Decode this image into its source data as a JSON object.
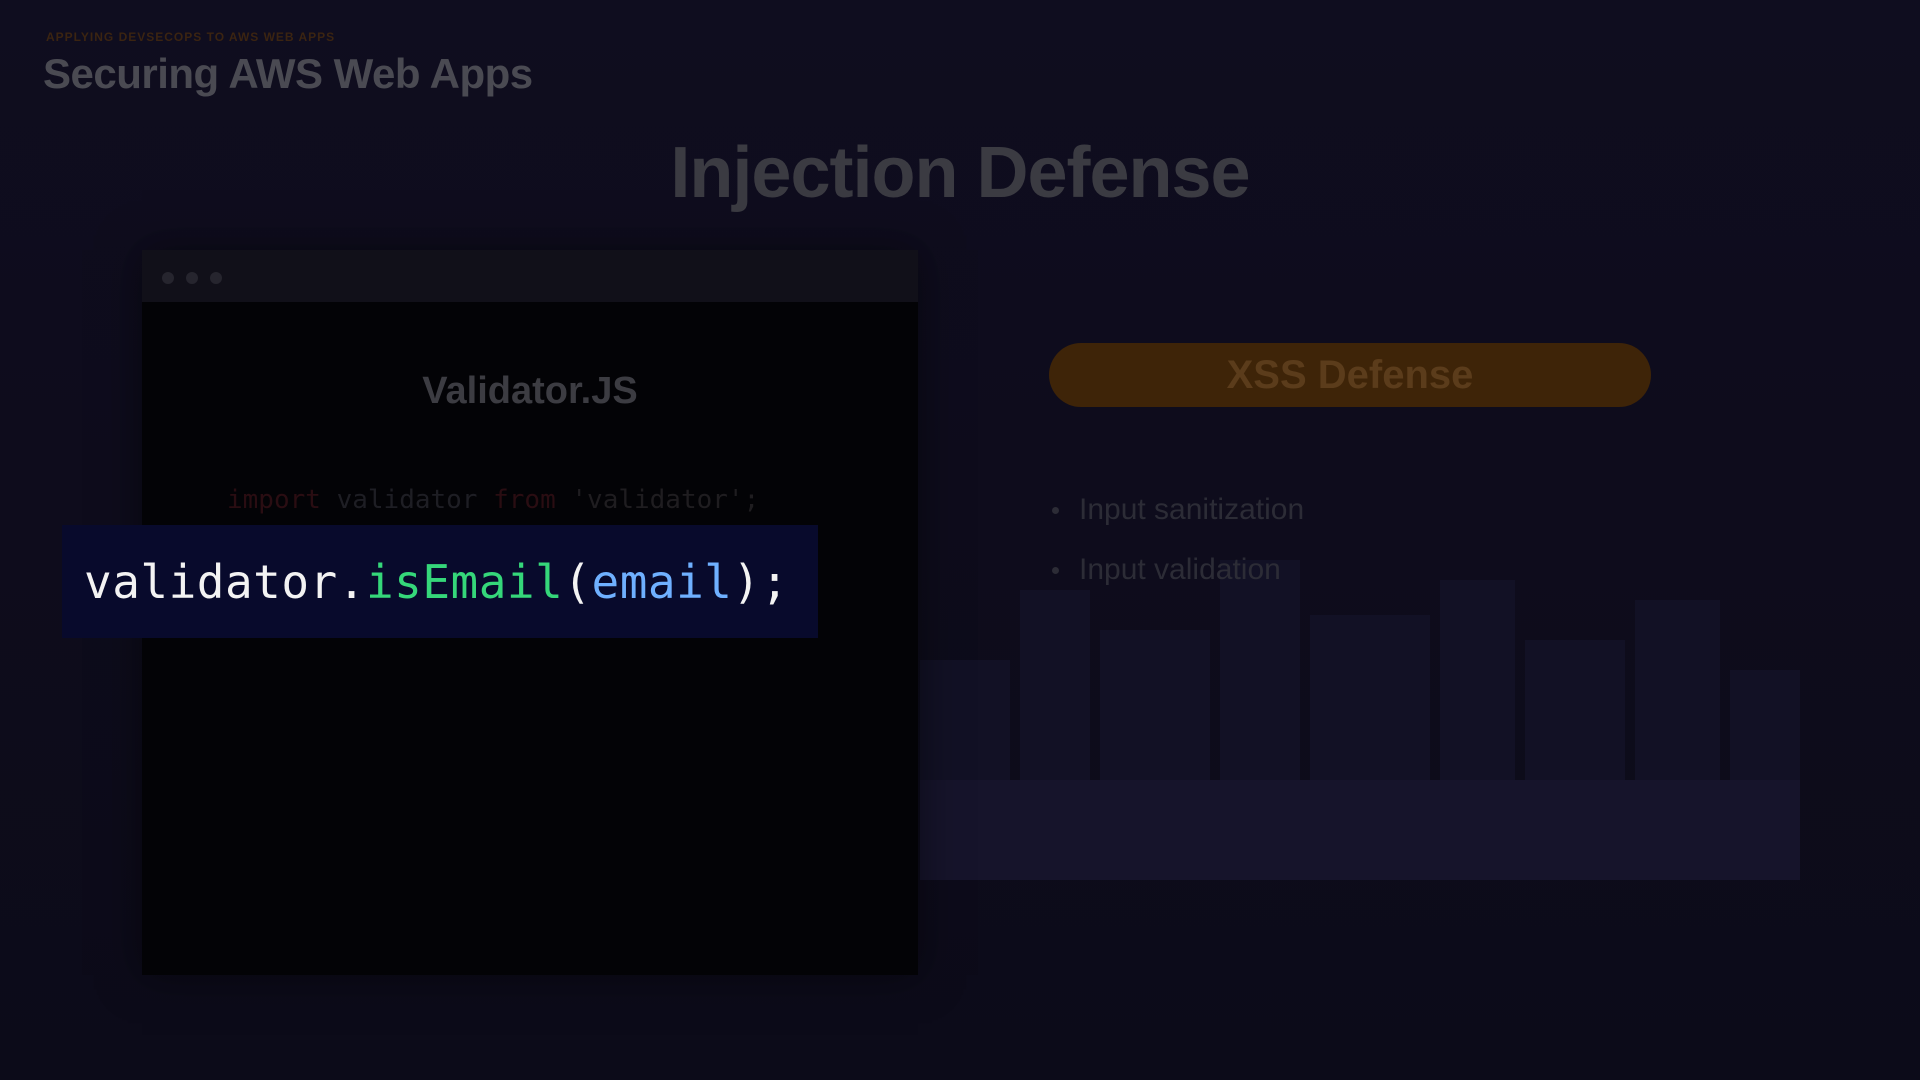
{
  "header": {
    "eyebrow": "APPLYING DEVSECOPS TO AWS WEB APPS",
    "deck_title": "Securing AWS Web Apps"
  },
  "slide": {
    "title": "Injection Defense"
  },
  "code_window": {
    "heading": "Validator.JS",
    "import_line": {
      "keyword_import": "import",
      "identifier": " validator ",
      "keyword_from": "from",
      "module": " 'validator';"
    },
    "callout": {
      "object": "validator",
      "dot": ".",
      "method": "isEmail",
      "open_paren": "(",
      "argument": "email",
      "close": ");"
    }
  },
  "right_panel": {
    "pill_label": "XSS Defense",
    "bullets": [
      {
        "label": "Input sanitization"
      },
      {
        "label": "Input validation"
      }
    ]
  },
  "colors": {
    "background": "#0e0c1c",
    "accent_orange": "#3e2408",
    "code_function": "#35d77a",
    "code_argument": "#6fb0ff",
    "callout_bg": "#080a2c"
  }
}
